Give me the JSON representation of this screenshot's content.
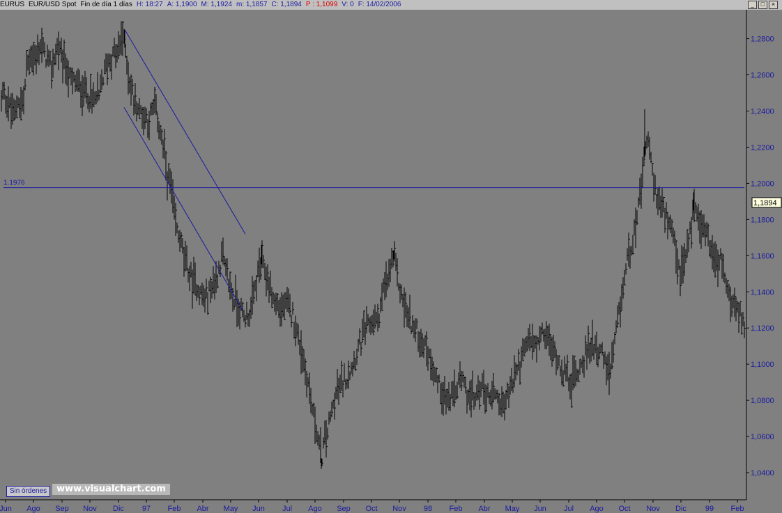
{
  "header": {
    "symbol": "EURUS",
    "description": "EUR/USD Spot",
    "period": "Fin de día 1 días",
    "time": "H: 18:27",
    "high": "A: 1,1900",
    "max": "M: 1,1924",
    "min": "m: 1,1857",
    "close": "C: 1,1894",
    "p": "P : 1,1099",
    "volume": "V: 0",
    "date": "F: 14/02/2006"
  },
  "window_buttons": [
    "_",
    "□",
    "×"
  ],
  "chart_data": {
    "type": "bar",
    "ohlc_style": "bars",
    "y_range": [
      1.025,
      1.296
    ],
    "y_ticks": [
      "1,0400",
      "1,0600",
      "1,0800",
      "1,1000",
      "1,1200",
      "1,1400",
      "1,1600",
      "1,1800",
      "1,2000",
      "1,2200",
      "1,2400",
      "1,2600",
      "1,2800"
    ],
    "y_tick_values": [
      1.04,
      1.06,
      1.08,
      1.1,
      1.12,
      1.14,
      1.16,
      1.18,
      1.2,
      1.22,
      1.24,
      1.26,
      1.28
    ],
    "x_ticks": [
      "Jun",
      "Ago",
      "Sep",
      "Nov",
      "Dic",
      "97",
      "Feb",
      "Abr",
      "May",
      "Jun",
      "Jul",
      "Ago",
      "Sep",
      "Oct",
      "Nov",
      "98",
      "Feb",
      "Abr",
      "May",
      "Jun",
      "Jul",
      "Ago",
      "Oct",
      "Nov",
      "Dic",
      "99",
      "Feb"
    ],
    "anchors": [
      [
        0,
        1.235
      ],
      [
        3,
        1.25
      ],
      [
        14,
        1.242
      ],
      [
        22,
        1.238
      ],
      [
        26,
        1.246
      ],
      [
        30,
        1.244
      ],
      [
        35,
        1.248
      ],
      [
        38,
        1.265
      ],
      [
        45,
        1.272
      ],
      [
        52,
        1.268
      ],
      [
        58,
        1.277
      ],
      [
        66,
        1.27
      ],
      [
        74,
        1.264
      ],
      [
        82,
        1.275
      ],
      [
        90,
        1.27
      ],
      [
        100,
        1.258
      ],
      [
        110,
        1.255
      ],
      [
        120,
        1.252
      ],
      [
        132,
        1.246
      ],
      [
        142,
        1.248
      ],
      [
        150,
        1.262
      ],
      [
        160,
        1.27
      ],
      [
        168,
        1.272
      ],
      [
        176,
        1.282
      ],
      [
        182,
        1.268
      ],
      [
        188,
        1.252
      ],
      [
        195,
        1.244
      ],
      [
        205,
        1.238
      ],
      [
        214,
        1.235
      ],
      [
        222,
        1.242
      ],
      [
        232,
        1.225
      ],
      [
        240,
        1.205
      ],
      [
        246,
        1.195
      ],
      [
        252,
        1.176
      ],
      [
        260,
        1.166
      ],
      [
        268,
        1.154
      ],
      [
        276,
        1.146
      ],
      [
        284,
        1.142
      ],
      [
        294,
        1.135
      ],
      [
        302,
        1.142
      ],
      [
        310,
        1.147
      ],
      [
        318,
        1.158
      ],
      [
        326,
        1.148
      ],
      [
        334,
        1.138
      ],
      [
        342,
        1.132
      ],
      [
        350,
        1.126
      ],
      [
        358,
        1.128
      ],
      [
        366,
        1.142
      ],
      [
        374,
        1.156
      ],
      [
        382,
        1.15
      ],
      [
        392,
        1.136
      ],
      [
        402,
        1.13
      ],
      [
        410,
        1.133
      ],
      [
        420,
        1.127
      ],
      [
        430,
        1.112
      ],
      [
        440,
        1.094
      ],
      [
        448,
        1.075
      ],
      [
        455,
        1.062
      ],
      [
        461,
        1.048
      ],
      [
        467,
        1.058
      ],
      [
        475,
        1.072
      ],
      [
        484,
        1.085
      ],
      [
        492,
        1.09
      ],
      [
        500,
        1.094
      ],
      [
        508,
        1.102
      ],
      [
        516,
        1.11
      ],
      [
        524,
        1.118
      ],
      [
        532,
        1.122
      ],
      [
        542,
        1.124
      ],
      [
        550,
        1.14
      ],
      [
        558,
        1.148
      ],
      [
        564,
        1.16
      ],
      [
        570,
        1.148
      ],
      [
        576,
        1.138
      ],
      [
        584,
        1.128
      ],
      [
        592,
        1.122
      ],
      [
        600,
        1.116
      ],
      [
        612,
        1.108
      ],
      [
        622,
        1.098
      ],
      [
        630,
        1.088
      ],
      [
        640,
        1.08
      ],
      [
        650,
        1.082
      ],
      [
        660,
        1.092
      ],
      [
        670,
        1.085
      ],
      [
        680,
        1.08
      ],
      [
        690,
        1.088
      ],
      [
        700,
        1.082
      ],
      [
        710,
        1.086
      ],
      [
        720,
        1.076
      ],
      [
        730,
        1.084
      ],
      [
        740,
        1.096
      ],
      [
        750,
        1.104
      ],
      [
        760,
        1.114
      ],
      [
        770,
        1.11
      ],
      [
        780,
        1.118
      ],
      [
        790,
        1.11
      ],
      [
        800,
        1.103
      ],
      [
        810,
        1.095
      ],
      [
        820,
        1.09
      ],
      [
        830,
        1.097
      ],
      [
        840,
        1.105
      ],
      [
        850,
        1.112
      ],
      [
        860,
        1.108
      ],
      [
        870,
        1.098
      ],
      [
        876,
        1.094
      ],
      [
        882,
        1.112
      ],
      [
        888,
        1.126
      ],
      [
        894,
        1.142
      ],
      [
        900,
        1.158
      ],
      [
        906,
        1.166
      ],
      [
        912,
        1.178
      ],
      [
        918,
        1.19
      ],
      [
        922,
        1.204
      ],
      [
        926,
        1.218
      ],
      [
        930,
        1.226
      ],
      [
        934,
        1.21
      ],
      [
        940,
        1.196
      ],
      [
        946,
        1.19
      ],
      [
        952,
        1.184
      ],
      [
        958,
        1.178
      ],
      [
        964,
        1.172
      ],
      [
        970,
        1.16
      ],
      [
        976,
        1.15
      ],
      [
        982,
        1.156
      ],
      [
        988,
        1.168
      ],
      [
        994,
        1.184
      ],
      [
        998,
        1.188
      ],
      [
        1004,
        1.18
      ],
      [
        1010,
        1.175
      ],
      [
        1016,
        1.172
      ],
      [
        1022,
        1.16
      ],
      [
        1028,
        1.155
      ],
      [
        1034,
        1.157
      ],
      [
        1040,
        1.148
      ],
      [
        1046,
        1.138
      ],
      [
        1052,
        1.13
      ],
      [
        1058,
        1.128
      ],
      [
        1064,
        1.126
      ],
      [
        1068,
        1.122
      ]
    ],
    "spikes": [
      [
        179,
        1.285
      ],
      [
        925,
        1.241
      ],
      [
        461,
        1.042
      ],
      [
        565,
        1.163
      ],
      [
        320,
        1.17
      ],
      [
        375,
        1.166
      ],
      [
        995,
        1.195
      ]
    ],
    "last_price": "1,1894",
    "horizontal_line": {
      "value": 1.1976,
      "label": "1.1976",
      "color": "#1a1aa0"
    },
    "trendlines": [
      {
        "from": [
          179,
          1.285
        ],
        "to": [
          352,
          1.172
        ],
        "color": "#1a1aa0"
      },
      {
        "from": [
          178,
          1.242
        ],
        "to": [
          348,
          1.13
        ],
        "color": "#1a1aa0"
      }
    ]
  },
  "footer": {
    "orders_button": "Sin órdenes",
    "brand": "www.visualchart.com"
  }
}
